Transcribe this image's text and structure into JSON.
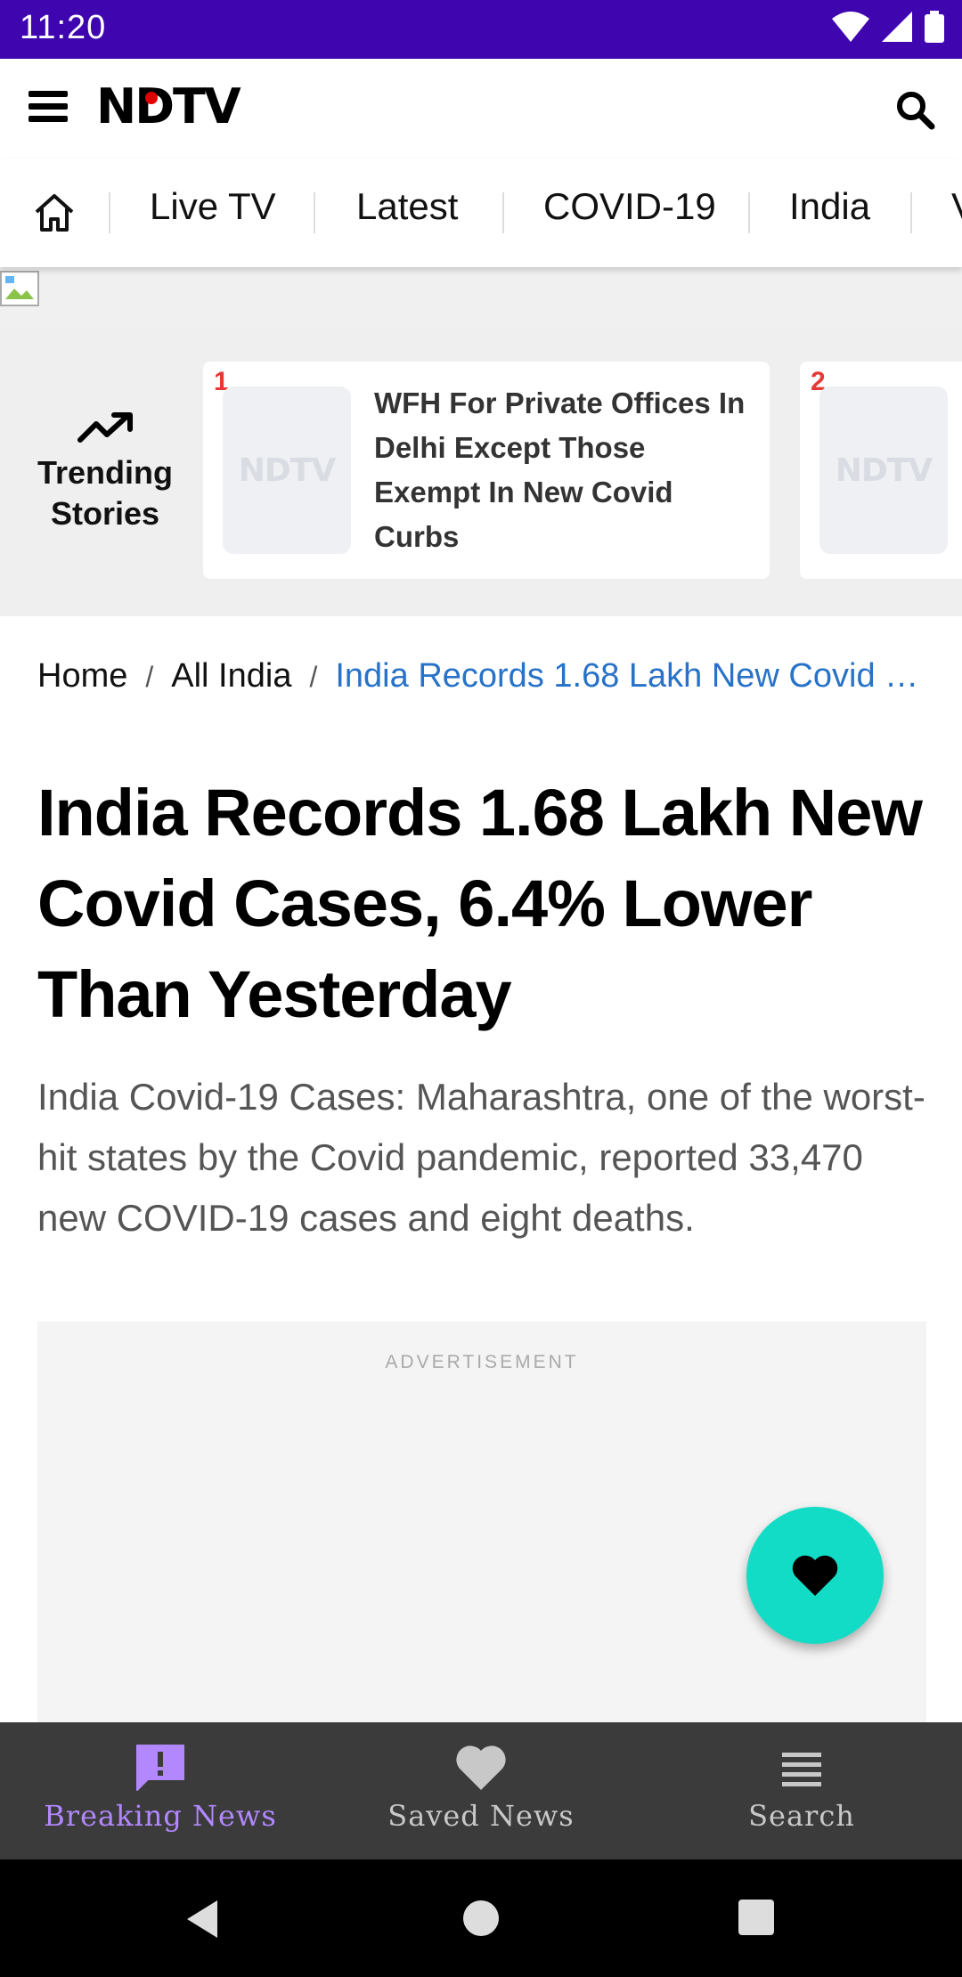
{
  "status_bar": {
    "time": "11:20"
  },
  "header": {
    "logo_text": "NDTV"
  },
  "nav": {
    "items": [
      {
        "label": "Live TV"
      },
      {
        "label": "Latest"
      },
      {
        "label": "COVID-19"
      },
      {
        "label": "India"
      },
      {
        "label": "V"
      }
    ]
  },
  "trending": {
    "label": "Trending Stories",
    "cards": [
      {
        "rank": "1",
        "title": "WFH For Private Offices In Delhi Except Those Exempt In New Covid Curbs",
        "thumb_text": "NDTV"
      },
      {
        "rank": "2",
        "title": "",
        "thumb_text": "NDTV"
      }
    ]
  },
  "breadcrumb": {
    "items": [
      "Home",
      "All India"
    ],
    "separator": "/",
    "current": "India Records 1.68 Lakh New Covid …"
  },
  "article": {
    "headline": "India Records 1.68 Lakh New Covid Cases, 6.4% Lower Than Yesterday",
    "summary": "India Covid-19 Cases: Maharashtra, one of the worst-hit states by the Covid pandemic, reported 33,470 new COVID-19 cases and eight deaths."
  },
  "ad": {
    "label": "ADVERTISEMENT"
  },
  "bottom_nav": {
    "items": [
      {
        "label": "Breaking News",
        "icon": "alert-message-icon",
        "active": true
      },
      {
        "label": "Saved News",
        "icon": "heart-icon",
        "active": false
      },
      {
        "label": "Search",
        "icon": "list-icon",
        "active": false
      }
    ]
  },
  "colors": {
    "status_bar": "#3f06b0",
    "fab": "#12dcc5",
    "breadcrumb_current": "#2872c8",
    "bottom_nav_active": "#b388ff",
    "trend_rank": "#e53935"
  }
}
